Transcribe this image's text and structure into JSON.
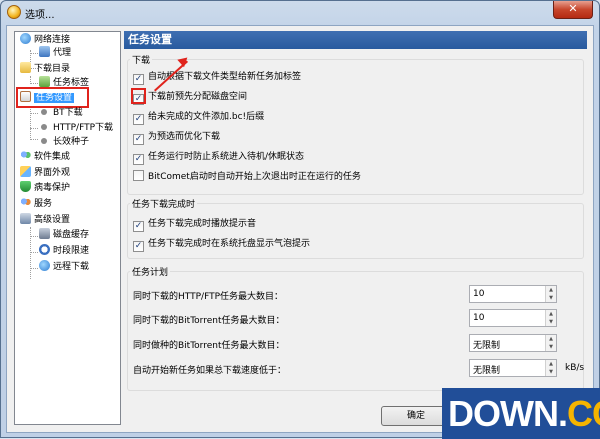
{
  "window": {
    "title": "选项...",
    "close_glyph": "✕"
  },
  "tree": {
    "items": [
      {
        "label": "网络连接",
        "icon": "network-icon"
      },
      {
        "label": "代理",
        "icon": "proxy-icon"
      },
      {
        "label": "下载目录",
        "icon": "folder-icon"
      },
      {
        "label": "任务标签",
        "icon": "tag-icon"
      },
      {
        "label": "任务设置",
        "icon": "task-icon",
        "selected": true
      },
      {
        "label": "BT下载",
        "icon": "bullet-icon"
      },
      {
        "label": "HTTP/FTP下载",
        "icon": "bullet-icon"
      },
      {
        "label": "长效种子",
        "icon": "bullet-icon"
      },
      {
        "label": "软件集成",
        "icon": "integration-icon"
      },
      {
        "label": "界面外观",
        "icon": "appearance-icon"
      },
      {
        "label": "病毒保护",
        "icon": "shield-icon"
      },
      {
        "label": "服务",
        "icon": "service-icon"
      },
      {
        "label": "高级设置",
        "icon": "advanced-icon"
      },
      {
        "label": "磁盘缓存",
        "icon": "disk-icon"
      },
      {
        "label": "时段限速",
        "icon": "clock-icon"
      },
      {
        "label": "远程下载",
        "icon": "remote-icon"
      }
    ]
  },
  "panel": {
    "header": "任务设置",
    "download_group": {
      "title": "下载",
      "options": [
        {
          "label": "自动根据下载文件类型给新任务加标签",
          "checked": true
        },
        {
          "label": "下载前预先分配磁盘空间",
          "checked": true
        },
        {
          "label": "给未完成的文件添加.bc!后缀",
          "checked": true
        },
        {
          "label": "为预选而优化下载",
          "checked": true
        },
        {
          "label": "任务运行时防止系统进入待机/休眠状态",
          "checked": true
        },
        {
          "label": "BitComet启动时自动开始上次退出时正在运行的任务",
          "checked": false
        }
      ]
    },
    "complete_group": {
      "title": "任务下载完成时",
      "options": [
        {
          "label": "任务下载完成时播放提示音",
          "checked": true
        },
        {
          "label": "任务下载完成时在系统托盘显示气泡提示",
          "checked": true
        }
      ]
    },
    "plan_group": {
      "title": "任务计划",
      "fields": [
        {
          "label": "同时下载的HTTP/FTP任务最大数目：",
          "value": "10"
        },
        {
          "label": "同时下载的BitTorrent任务最大数目：",
          "value": "10"
        },
        {
          "label": "同时做种的BitTorrent任务最大数目：",
          "value": "无限制"
        },
        {
          "label": "自动开始新任务如果总下载速度低于：",
          "value": "无限制",
          "unit": "kB/s"
        }
      ]
    }
  },
  "buttons": {
    "ok": "确定"
  },
  "watermark": {
    "main": "DOWN",
    "dot": ".",
    "suffix": "CC"
  }
}
